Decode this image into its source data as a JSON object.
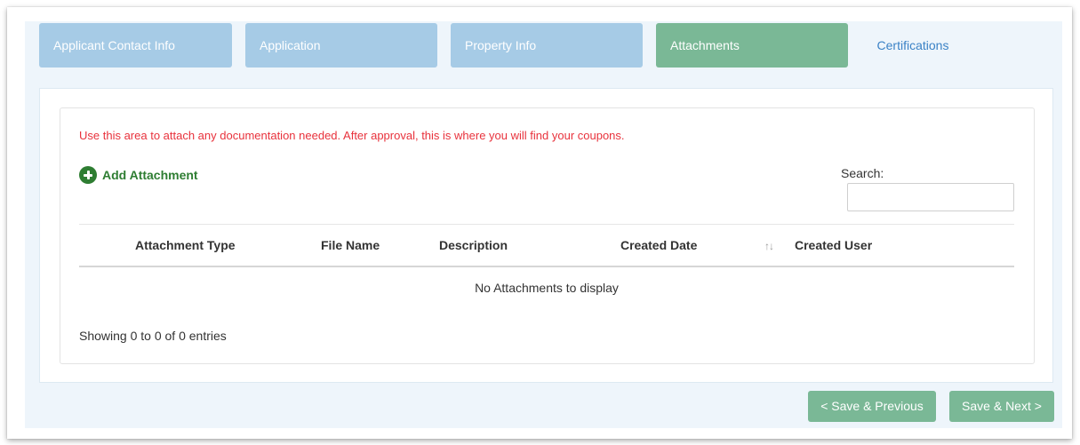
{
  "tabs": [
    {
      "label": "Applicant Contact Info",
      "state": "inactive"
    },
    {
      "label": "Application",
      "state": "inactive"
    },
    {
      "label": "Property Info",
      "state": "inactive"
    },
    {
      "label": "Attachments",
      "state": "active"
    },
    {
      "label": "Certifications",
      "state": "link"
    }
  ],
  "notice": "Use this area to attach any documentation needed. After approval, this is where you will find your coupons.",
  "add_attachment": {
    "label": "Add Attachment",
    "icon": "plus-circle-icon"
  },
  "search": {
    "label": "Search:",
    "value": "",
    "placeholder": ""
  },
  "table": {
    "columns": [
      "Attachment Type",
      "File Name",
      "Description",
      "Created Date",
      "Created User"
    ],
    "sort_icon": "↑↓",
    "empty_message": "No Attachments to display",
    "info": "Showing 0 to 0 of 0 entries"
  },
  "buttons": {
    "previous": "< Save & Previous",
    "next": "Save & Next >"
  },
  "colors": {
    "tab_inactive": "#a6cbe6",
    "tab_active": "#7ab896",
    "link": "#3b82c6",
    "notice_text": "#e8323c",
    "add_attachment": "#2e7d32",
    "button": "#7ab896",
    "panel_bg": "#eef5fb"
  }
}
